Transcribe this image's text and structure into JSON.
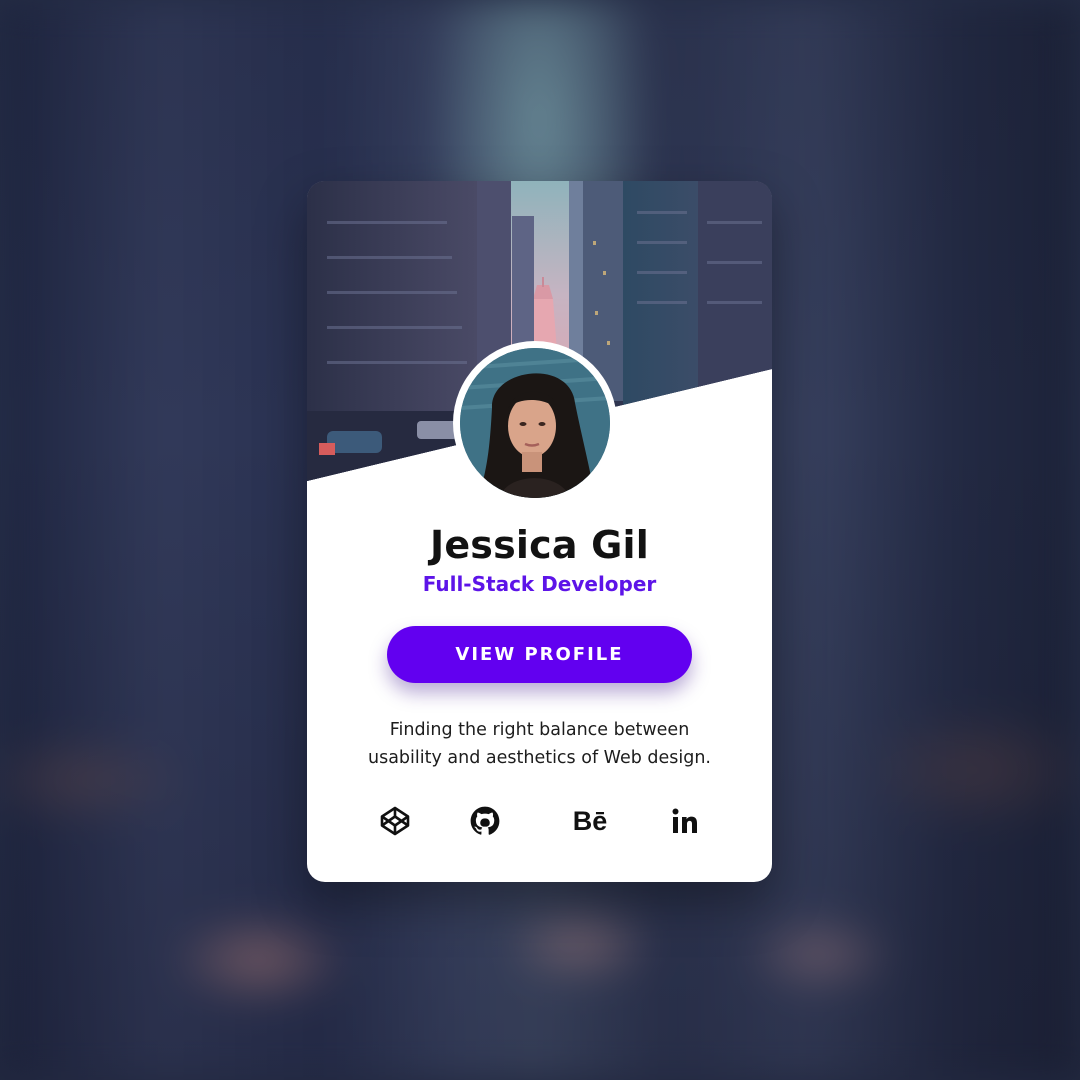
{
  "profile": {
    "name": "Jessica Gil",
    "role": "Full-Stack Developer",
    "button_label": "VIEW PROFILE",
    "bio_line1": "Finding the right balance between",
    "bio_line2": "usability and aesthetics of Web design."
  },
  "socials": [
    {
      "icon": "codepen-icon",
      "label": ""
    },
    {
      "icon": "github-icon",
      "label": ""
    },
    {
      "icon": "behance-icon",
      "label": "Bē"
    },
    {
      "icon": "linkedin-icon",
      "label": ""
    }
  ],
  "colors": {
    "accent": "#6200f0",
    "role_text": "#5d14e8",
    "card_bg": "#ffffff"
  }
}
